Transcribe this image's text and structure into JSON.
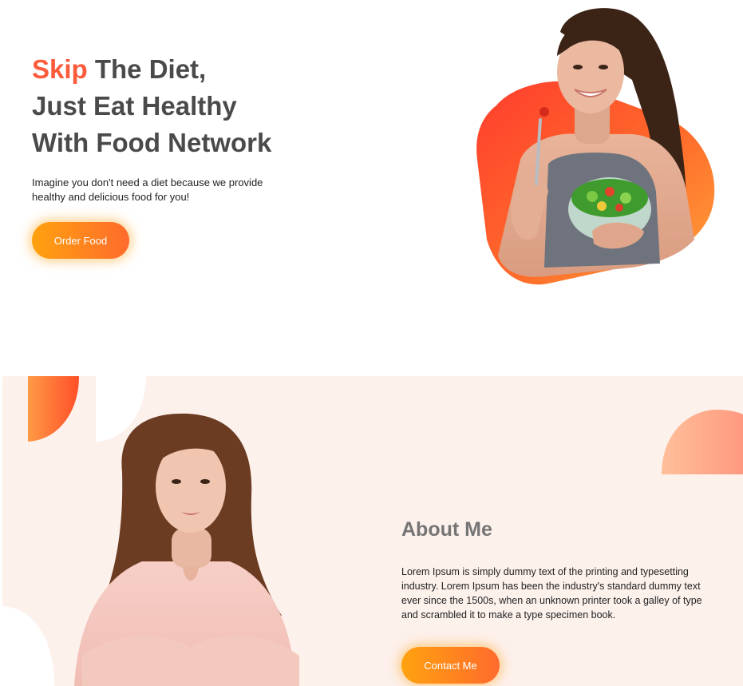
{
  "hero": {
    "title_accent": "Skip",
    "title_line1_rest": " The Diet,",
    "title_line2": "Just Eat Healthy",
    "title_line3": "With Food Network",
    "description": "Imagine you don't need a diet because we provide healthy and delicious food for you!",
    "button_label": "Order Food"
  },
  "about": {
    "title": "About Me",
    "text": "Lorem Ipsum is simply dummy text of the printing and typesetting industry. Lorem Ipsum has been the industry's standard dummy text ever since the 1500s, when an unknown printer took a galley of type and scrambled it to make a type specimen book.",
    "button_label": "Contact Me"
  },
  "colors": {
    "accent": "#fb5b3b",
    "button_gradient_start": "#ffa20f",
    "button_gradient_end": "#ff6b2c",
    "about_background": "#fdf1ec"
  },
  "images": {
    "hero": "woman-eating-salad-image",
    "about": "woman-portrait-image"
  }
}
